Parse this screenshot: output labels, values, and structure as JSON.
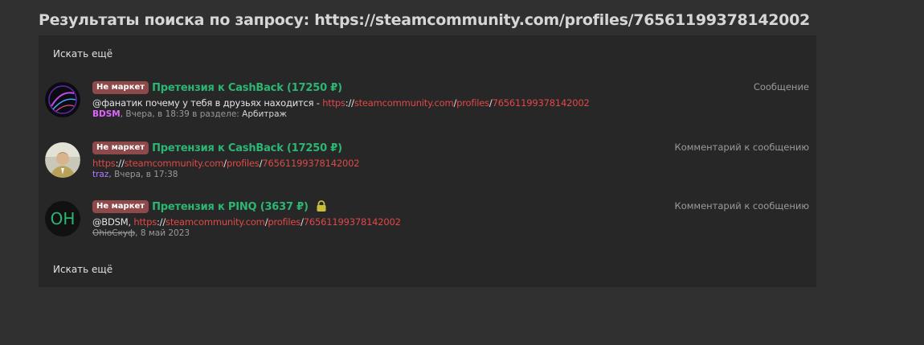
{
  "page": {
    "title": "Результаты поиска по запросу: https://steamcommunity.com/profiles/76561199378142002",
    "search_more_label": "Искать ещё"
  },
  "results": [
    {
      "badge": "Не маркет",
      "title": "Претензия к CashBack (17250 ₽)",
      "type_label": "Сообщение",
      "snippet_prefix": "@фанатик почему у тебя в друзьях находится - ",
      "link_parts": [
        "https",
        "://",
        "steamcommunity.com",
        "/",
        "profiles",
        "/",
        "76561199378142002"
      ],
      "author": "BDSM",
      "date": ", Вчера, в 18:39 в разделе: ",
      "section": "Арбитраж",
      "avatar_icon": "dark-swirl-avatar-icon"
    },
    {
      "badge": "Не маркет",
      "title": "Претензия к CashBack (17250 ₽)",
      "type_label": "Комментарий к сообщению",
      "snippet_prefix": "",
      "link_parts": [
        "https",
        "://",
        "steamcommunity.com",
        "/",
        "profiles",
        "/",
        "76561199378142002"
      ],
      "author": "traz",
      "date": ", Вчера, в 17:38",
      "avatar_icon": "person-photo-avatar-icon"
    },
    {
      "badge": "Не маркет",
      "title": "Претензия к PINQ (3637 ₽)",
      "type_label": "Комментарий к сообщению",
      "snippet_prefix": "@BDSM, ",
      "link_parts": [
        "https",
        "://",
        "steamcommunity.com",
        "/",
        "profiles",
        "/",
        "76561199378142002"
      ],
      "author": "OhioСкуф",
      "date": ", 8 май 2023",
      "avatar_text": "OH",
      "lock_icon": "lock-icon"
    }
  ],
  "colors": {
    "background": "#303030",
    "panel": "#272727",
    "title_green": "#2bb673",
    "link_red": "#e04848",
    "badge_bg": "#8e4a4a",
    "author_pink": "#e064ff",
    "author_purple": "#b07cff",
    "lock_yellow": "#c9c03a"
  }
}
